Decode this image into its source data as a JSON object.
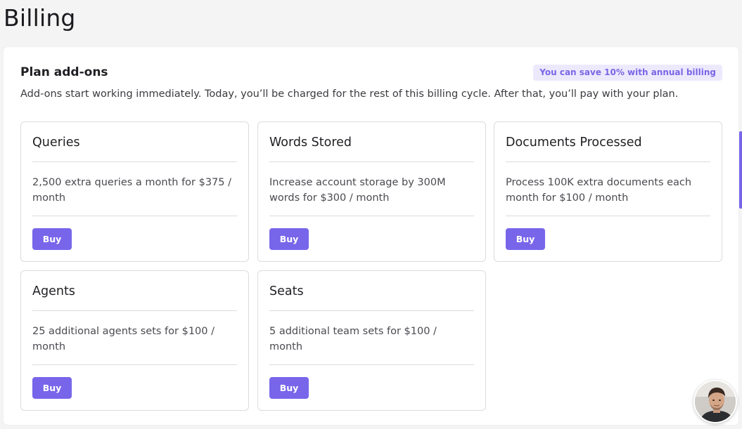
{
  "page": {
    "title": "Billing"
  },
  "addons": {
    "title": "Plan add-ons",
    "badge": "You can save 10% with annual billing",
    "description": "Add-ons start working immediately. Today, you’ll be charged for the rest of this billing cycle. After that, you’ll pay with your plan.",
    "cards": [
      {
        "title": "Queries",
        "description": "2,500 extra queries a month for $375 / month",
        "button": "Buy"
      },
      {
        "title": "Words Stored",
        "description": "Increase account storage by 300M words for $300 / month",
        "button": "Buy"
      },
      {
        "title": "Documents Processed",
        "description": "Process 100K extra documents each month for $100 / month",
        "button": "Buy"
      },
      {
        "title": "Agents",
        "description": "25 additional agents sets for $100 / month",
        "button": "Buy"
      },
      {
        "title": "Seats",
        "description": "5 additional team sets for $100 / month",
        "button": "Buy"
      }
    ]
  },
  "colors": {
    "accent": "#7766ea",
    "badge_bg": "#ede9fd",
    "badge_text": "#7a66e6",
    "background": "#f4f4f5"
  },
  "icons": {
    "support_avatar": "user-avatar"
  }
}
